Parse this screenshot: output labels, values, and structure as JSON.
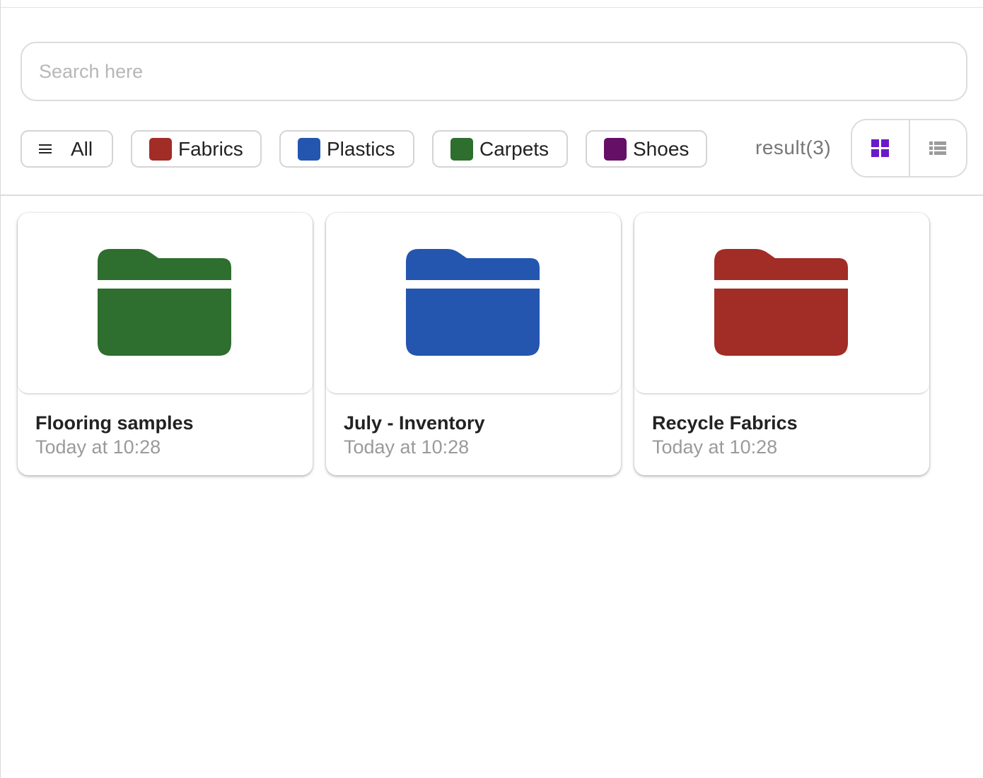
{
  "search": {
    "placeholder": "Search here",
    "value": ""
  },
  "filters": [
    {
      "label": "All",
      "icon": "menu-icon"
    },
    {
      "label": "Fabrics",
      "color": "#A22C26"
    },
    {
      "label": "Plastics",
      "color": "#2456B0"
    },
    {
      "label": "Carpets",
      "color": "#2E6E2E"
    },
    {
      "label": "Shoes",
      "color": "#651066"
    }
  ],
  "result_text": "result(3)",
  "view": {
    "selected": "grid",
    "grid_icon": "grid-view-icon",
    "list_icon": "list-view-icon",
    "active_color": "#6A1BC9",
    "inactive_color": "#9c9c9c"
  },
  "items": [
    {
      "title": "Flooring samples",
      "time": "Today at 10:28",
      "folder_color": "#2E6E2E",
      "icon": "folder-icon"
    },
    {
      "title": "July - Inventory",
      "time": "Today at 10:28",
      "folder_color": "#2456B0",
      "icon": "folder-icon"
    },
    {
      "title": "Recycle Fabrics",
      "time": "Today at 10:28",
      "folder_color": "#A22C26",
      "icon": "folder-icon"
    }
  ]
}
